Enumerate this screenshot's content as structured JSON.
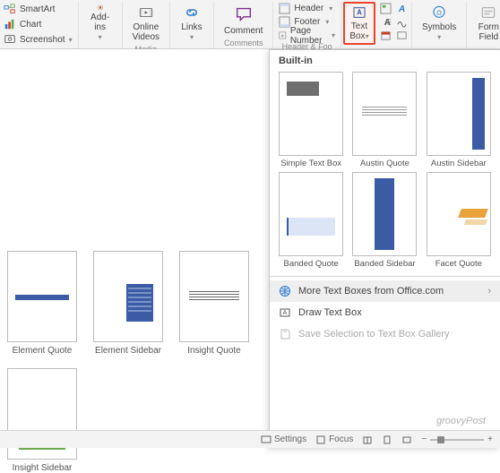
{
  "ribbon": {
    "left_items": [
      {
        "label": "SmartArt",
        "icon": "smartart-icon"
      },
      {
        "label": "Chart",
        "icon": "chart-icon"
      },
      {
        "label": "Screenshot",
        "icon": "screenshot-icon"
      }
    ],
    "groups": {
      "addins": {
        "label": "Add-ins"
      },
      "media": {
        "label": "Media",
        "button": "Online Videos"
      },
      "links": {
        "button": "Links"
      },
      "comments": {
        "label": "Comments",
        "button": "Comment"
      },
      "headerfooter": {
        "label": "Header & Foo",
        "items": [
          "Header",
          "Footer",
          "Page Number"
        ]
      },
      "text": {
        "button": "Text Box"
      },
      "symbols": {
        "button": "Symbols"
      },
      "formfield": {
        "button": "Form Field"
      }
    }
  },
  "thumbs_left": [
    {
      "label": "Element Quote"
    },
    {
      "label": "Element Sidebar"
    },
    {
      "label": "Insight Quote"
    },
    {
      "label": "Insight Sidebar"
    }
  ],
  "gallery": {
    "header": "Built-in",
    "items": [
      {
        "label": "Simple Text Box"
      },
      {
        "label": "Austin Quote"
      },
      {
        "label": "Austin Sidebar"
      },
      {
        "label": "Banded Quote"
      },
      {
        "label": "Banded Sidebar"
      },
      {
        "label": "Facet Quote"
      }
    ],
    "menu": [
      {
        "label": "More Text Boxes from Office.com",
        "icon": "globe-icon",
        "hover": true,
        "chevron": true
      },
      {
        "label": "Draw Text Box",
        "icon": "draw-icon"
      },
      {
        "label": "Save Selection to Text Box Gallery",
        "icon": "save-icon",
        "disabled": true
      }
    ]
  },
  "status": {
    "settings": "Settings",
    "focus": "Focus",
    "zoom": "40%"
  },
  "watermark": "groovyPost"
}
